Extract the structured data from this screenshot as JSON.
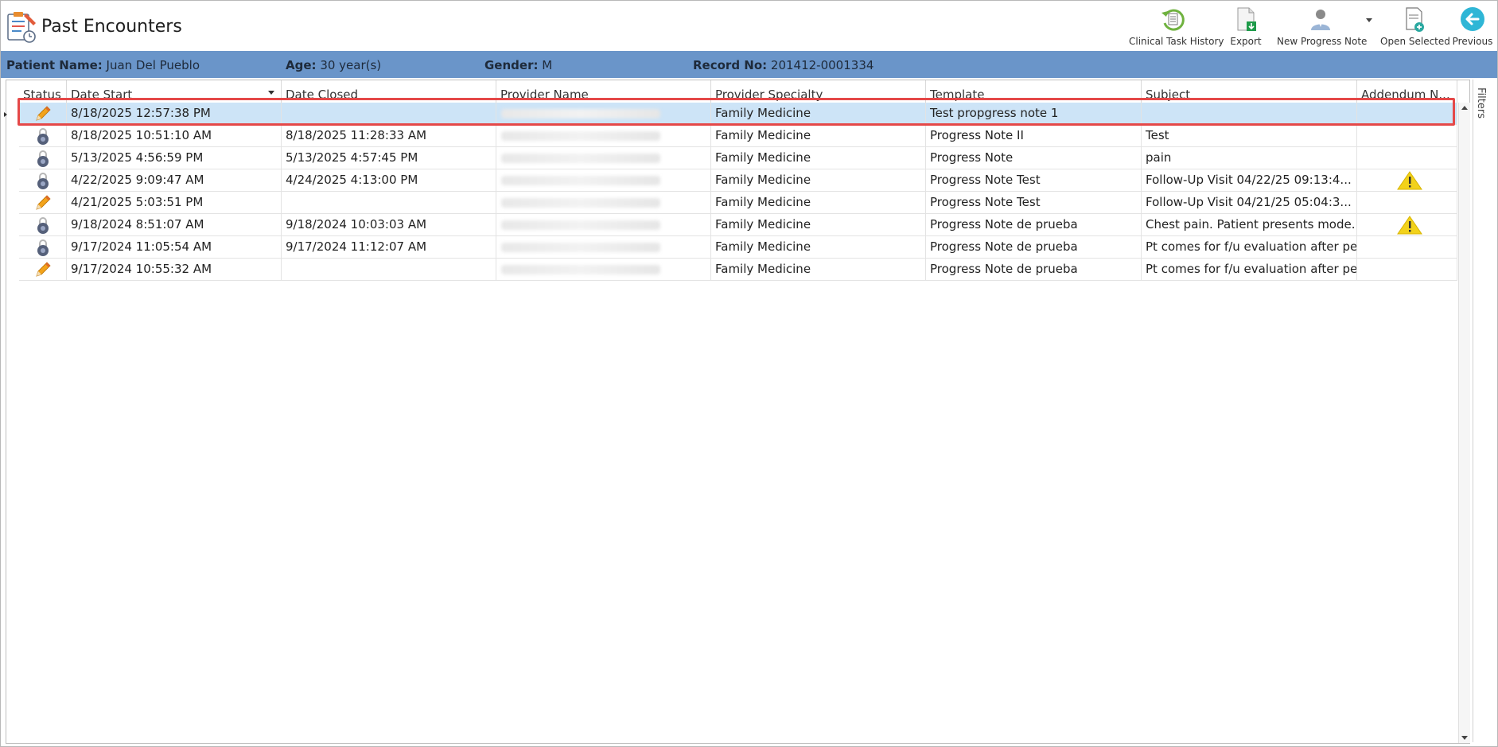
{
  "header": {
    "title": "Past Encounters",
    "toolbar": [
      {
        "label": "Clinical Task History",
        "icon": "clinical-task-history-icon"
      },
      {
        "label": "Export",
        "icon": "export-icon"
      },
      {
        "label": "New Progress Note",
        "icon": "new-progress-note-icon"
      },
      {
        "label": "Open Selected",
        "icon": "open-selected-icon"
      },
      {
        "label": "Previous",
        "icon": "previous-arrow-icon"
      }
    ]
  },
  "patient": {
    "name_label": "Patient Name:",
    "name_value": "Juan Del Pueblo",
    "age_label": "Age:",
    "age_value": "30 year(s)",
    "gender_label": "Gender:",
    "gender_value": "M",
    "record_label": "Record No:",
    "record_value": "201412-0001334"
  },
  "grid": {
    "columns": [
      "Status",
      "Date Start",
      "Date Closed",
      "Provider Name",
      "Provider Specialty",
      "Template",
      "Subject",
      "Addendum N..."
    ],
    "rows": [
      {
        "status": "pencil-icon",
        "date_start": "8/18/2025 12:57:38 PM",
        "date_closed": "",
        "specialty": "Family Medicine",
        "template": "Test propgress note 1",
        "subject": "",
        "addendum": ""
      },
      {
        "status": "lock-icon",
        "date_start": "8/18/2025 10:51:10 AM",
        "date_closed": "8/18/2025 11:28:33 AM",
        "specialty": "Family Medicine",
        "template": "Progress Note II",
        "subject": "Test",
        "addendum": ""
      },
      {
        "status": "lock-icon",
        "date_start": "5/13/2025 4:56:59 PM",
        "date_closed": "5/13/2025 4:57:45 PM",
        "specialty": "Family Medicine",
        "template": "Progress Note",
        "subject": "pain",
        "addendum": ""
      },
      {
        "status": "lock-icon",
        "date_start": "4/22/2025 9:09:47 AM",
        "date_closed": "4/24/2025 4:13:00 PM",
        "specialty": "Family Medicine",
        "template": "Progress Note Test",
        "subject": " Follow-Up Visit   04/22/25 09:13:4...",
        "addendum": "warning-icon"
      },
      {
        "status": "pencil-icon",
        "date_start": "4/21/2025 5:03:51 PM",
        "date_closed": "",
        "specialty": "Family Medicine",
        "template": "Progress Note Test",
        "subject": " Follow-Up Visit   04/21/25 05:04:3...",
        "addendum": ""
      },
      {
        "status": "lock-icon",
        "date_start": "9/18/2024 8:51:07 AM",
        "date_closed": "9/18/2024 10:03:03 AM",
        "specialty": "Family Medicine",
        "template": "Progress Note de prueba",
        "subject": " Chest pain. Patient presents mode...",
        "addendum": "warning-icon"
      },
      {
        "status": "lock-icon",
        "date_start": "9/17/2024 11:05:54 AM",
        "date_closed": "9/17/2024 11:12:07 AM",
        "specialty": "Family Medicine",
        "template": "Progress Note de prueba",
        "subject": "Pt comes for f/u evaluation after pe...",
        "addendum": ""
      },
      {
        "status": "pencil-icon",
        "date_start": "9/17/2024 10:55:32 AM",
        "date_closed": "",
        "specialty": "Family Medicine",
        "template": "Progress Note de prueba",
        "subject": "Pt comes for f/u evaluation after pe...",
        "addendum": ""
      }
    ]
  },
  "side": {
    "filters_label": "Filters"
  }
}
